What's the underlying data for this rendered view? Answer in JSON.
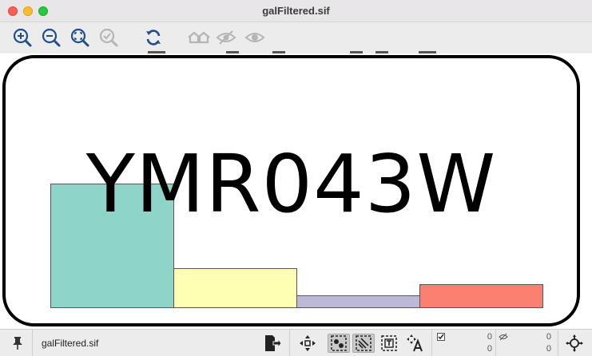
{
  "window": {
    "title": "galFiltered.sif"
  },
  "toolbar": {
    "buttons": [
      {
        "name": "zoom-in-icon",
        "enabled": true
      },
      {
        "name": "zoom-out-icon",
        "enabled": true
      },
      {
        "name": "zoom-fit-icon",
        "enabled": true
      },
      {
        "name": "zoom-selected-icon",
        "enabled": false
      },
      {
        "name": "refresh-icon",
        "enabled": true
      },
      {
        "name": "home-icon",
        "enabled": false
      },
      {
        "name": "hide-icon",
        "enabled": false
      },
      {
        "name": "show-icon",
        "enabled": false
      }
    ]
  },
  "canvas": {
    "node_label": "YMR043W",
    "chart_data": {
      "type": "bar",
      "categories": [
        "",
        "",
        "",
        ""
      ],
      "values": [
        1.0,
        0.32,
        0.1,
        0.19
      ],
      "colors": [
        "#8fd4c8",
        "#ffffb3",
        "#bcb8d8",
        "#fb8072"
      ]
    }
  },
  "statusbar": {
    "file_name": "galFiltered.sif",
    "selected_nodes": "0",
    "selected_edges": "0",
    "hidden_nodes": "0",
    "hidden_edges": "0"
  },
  "colors": {
    "accent": "#1f4e8c",
    "disabled": "#b5b5b5"
  }
}
